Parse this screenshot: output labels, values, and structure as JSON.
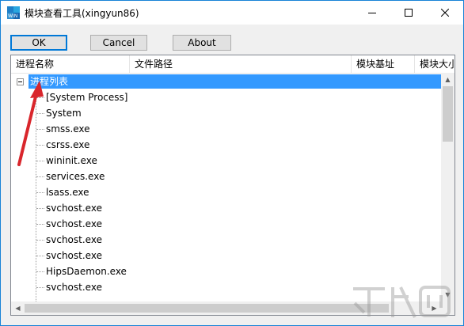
{
  "window": {
    "title": "模块查看工具(xingyun86)",
    "icon_name": "app-icon",
    "controls": [
      "minimize-icon",
      "maximize-icon",
      "close-icon"
    ]
  },
  "toolbar": {
    "ok_label": "OK",
    "cancel_label": "Cancel",
    "about_label": "About"
  },
  "columns": [
    "进程名称",
    "文件路径",
    "模块基址",
    "模块大小"
  ],
  "tree": {
    "root_label": "进程列表",
    "root_expanded": true,
    "processes": [
      "[System Process]",
      "System",
      "smss.exe",
      "csrss.exe",
      "wininit.exe",
      "services.exe",
      "lsass.exe",
      "svchost.exe",
      "svchost.exe",
      "svchost.exe",
      "svchost.exe",
      "HipsDaemon.exe",
      "svchost.exe"
    ]
  },
  "colors": {
    "selection": "#3399ff",
    "accent_border": "#0078d7",
    "annotation_arrow": "#d9262c"
  }
}
